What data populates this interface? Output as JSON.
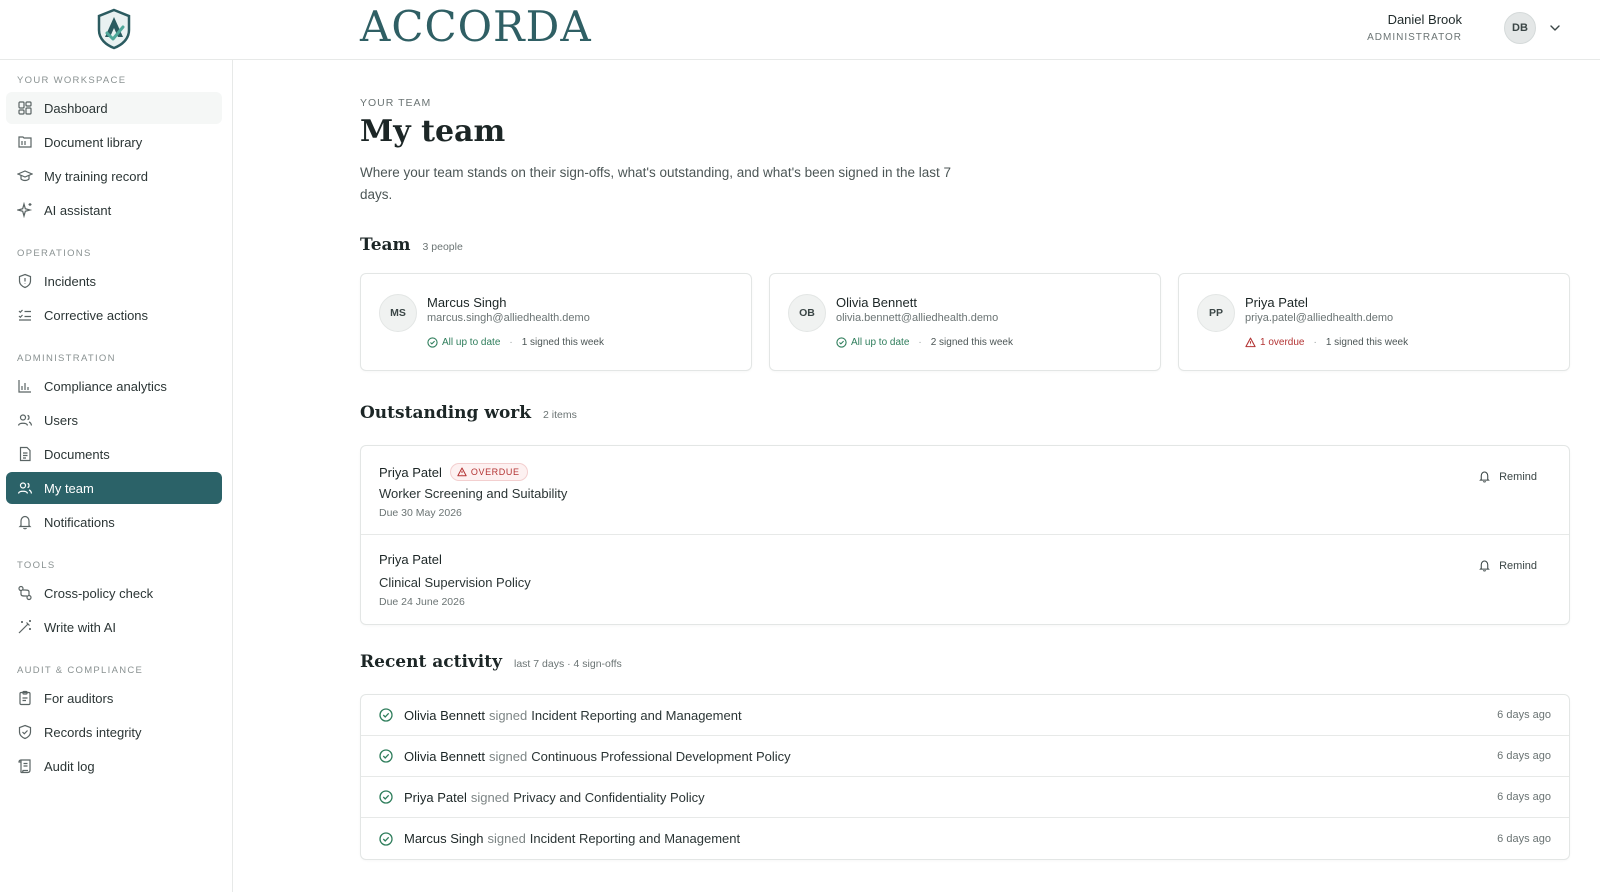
{
  "app": {
    "brand": "ACCORDA",
    "accent_color": "#2b6268"
  },
  "user": {
    "name": "Daniel Brook",
    "role": "ADMINISTRATOR",
    "initials": "DB"
  },
  "sidebar": {
    "sections": [
      {
        "label": "YOUR WORKSPACE",
        "items": [
          {
            "label": "Dashboard",
            "icon": "dashboard-icon"
          },
          {
            "label": "Document library",
            "icon": "library-icon"
          },
          {
            "label": "My training record",
            "icon": "graduation-cap-icon"
          },
          {
            "label": "AI assistant",
            "icon": "sparkle-icon"
          }
        ]
      },
      {
        "label": "OPERATIONS",
        "items": [
          {
            "label": "Incidents",
            "icon": "shield-alert-icon"
          },
          {
            "label": "Corrective actions",
            "icon": "checklist-icon"
          }
        ]
      },
      {
        "label": "ADMINISTRATION",
        "items": [
          {
            "label": "Compliance analytics",
            "icon": "bar-chart-icon"
          },
          {
            "label": "Users",
            "icon": "users-icon"
          },
          {
            "label": "Documents",
            "icon": "document-icon"
          },
          {
            "label": "My team",
            "icon": "team-icon",
            "active": true
          },
          {
            "label": "Notifications",
            "icon": "bell-icon"
          }
        ]
      },
      {
        "label": "TOOLS",
        "items": [
          {
            "label": "Cross-policy check",
            "icon": "compare-icon"
          },
          {
            "label": "Write with AI",
            "icon": "magic-wand-icon"
          }
        ]
      },
      {
        "label": "AUDIT & COMPLIANCE",
        "items": [
          {
            "label": "For auditors",
            "icon": "clipboard-icon"
          },
          {
            "label": "Records integrity",
            "icon": "shield-check-icon"
          },
          {
            "label": "Audit log",
            "icon": "scroll-icon"
          }
        ]
      }
    ]
  },
  "page": {
    "eyebrow": "YOUR TEAM",
    "title": "My team",
    "description": "Where your team stands on their sign-offs, what's outstanding, and what's been signed in the last 7 days."
  },
  "team": {
    "title": "Team",
    "count": "3 people",
    "members": [
      {
        "initials": "MS",
        "name": "Marcus Singh",
        "email": "marcus.singh@alliedhealth.demo",
        "status": "All up to date",
        "status_type": "ok",
        "week": "1 signed this week"
      },
      {
        "initials": "OB",
        "name": "Olivia Bennett",
        "email": "olivia.bennett@alliedhealth.demo",
        "status": "All up to date",
        "status_type": "ok",
        "week": "2 signed this week"
      },
      {
        "initials": "PP",
        "name": "Priya Patel",
        "email": "priya.patel@alliedhealth.demo",
        "status": "1 overdue",
        "status_type": "overdue",
        "week": "1 signed this week"
      }
    ]
  },
  "outstanding": {
    "title": "Outstanding work",
    "count": "2 items",
    "remind_label": "Remind",
    "items": [
      {
        "person": "Priya Patel",
        "badge": "OVERDUE",
        "document": "Worker Screening and Suitability",
        "due": "Due 30 May 2026"
      },
      {
        "person": "Priya Patel",
        "badge": "",
        "document": "Clinical Supervision Policy",
        "due": "Due 24 June 2026"
      }
    ]
  },
  "activity": {
    "title": "Recent activity",
    "count": "last 7 days · 4 sign-offs",
    "verb": "signed",
    "items": [
      {
        "person": "Olivia Bennett",
        "document": "Incident Reporting and Management",
        "when": "6 days ago"
      },
      {
        "person": "Olivia Bennett",
        "document": "Continuous Professional Development Policy",
        "when": "6 days ago"
      },
      {
        "person": "Priya Patel",
        "document": "Privacy and Confidentiality Policy",
        "when": "6 days ago"
      },
      {
        "person": "Marcus Singh",
        "document": "Incident Reporting and Management",
        "when": "6 days ago"
      }
    ]
  }
}
